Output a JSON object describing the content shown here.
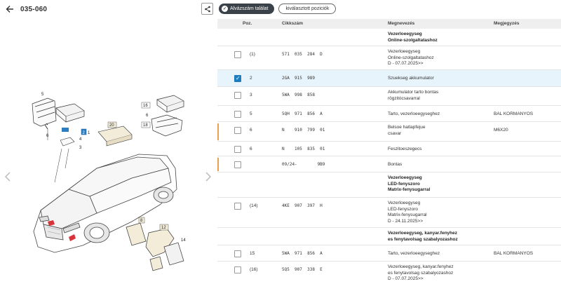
{
  "header": {
    "title": "035-060"
  },
  "filters": {
    "found_label": "Alvázszám találat",
    "selected_label": "kiválasztott poziciók"
  },
  "columns": {
    "pos": "Poz.",
    "cikk": "Cikkszám",
    "desc": "Megnevezés",
    "note": "Megjegyzés"
  },
  "diagram": {
    "callouts": [
      "5",
      "2",
      "1",
      "6",
      "3",
      "4",
      "20",
      "16",
      "6",
      "18",
      "8",
      "12",
      "14"
    ]
  },
  "rows": [
    {
      "pos": "",
      "cikk": "",
      "desc": [
        "Vezerloeegyseg",
        "Online-szolgaltatashoz"
      ],
      "note": "",
      "bold": true,
      "checkbox": false
    },
    {
      "pos": "(1)",
      "cikk": "571  035  284  D",
      "desc": [
        "Vezerloeegyseg",
        "Online-szolgaltatashoz",
        "D - 07.07.2025>>"
      ],
      "note": "",
      "bold": false,
      "checkbox": true
    },
    {
      "pos": "2",
      "cikk": "2GA  915  989",
      "desc": [
        "Szuekseg akkumulator"
      ],
      "note": "",
      "bold": false,
      "checkbox": true,
      "selected": true
    },
    {
      "pos": "3",
      "cikk": "5WA  998  858",
      "desc": [
        "Akkumulator tarto bontas",
        "rögzitócsavarral"
      ],
      "note": "",
      "bold": false,
      "checkbox": true
    },
    {
      "pos": "5",
      "cikk": "5QH  971  856  A",
      "desc": [
        "Tarto, vezerloeegyseghez"
      ],
      "note": "BAL KORMANYOS",
      "bold": false,
      "checkbox": true
    },
    {
      "pos": "6",
      "cikk": "N    910  799  01",
      "desc": [
        "Belsoe hatlapfejue",
        "csavar"
      ],
      "note": "M6X20",
      "bold": false,
      "checkbox": true,
      "marked": true
    },
    {
      "pos": "6",
      "cikk": "N    105  835  01",
      "desc": [
        "Feszitoeszegecs"
      ],
      "note": "",
      "bold": false,
      "checkbox": true
    },
    {
      "pos": "",
      "cikk": "09/24-        9B9",
      "desc": [
        "Bontas"
      ],
      "note": "",
      "bold": false,
      "checkbox": true,
      "marked": true
    },
    {
      "pos": "",
      "cikk": "",
      "desc": [
        "Vezerloeegyseg",
        "LED-fenyszoro",
        "Matrix-fenysugarral"
      ],
      "note": "",
      "bold": true,
      "checkbox": false
    },
    {
      "pos": "(14)",
      "cikk": "4KE  907  397  H",
      "desc": [
        "Vezerloeegyseg",
        "LED-fenyszoro",
        "Matrix-fenysugarral",
        "D - 24.11.2025>>"
      ],
      "note": "",
      "bold": false,
      "checkbox": true
    },
    {
      "pos": "",
      "cikk": "",
      "desc": [
        "Vezerloeegyseg, kanyar.fenyhez",
        "es fenytavolsag szabalyozashoz"
      ],
      "note": "",
      "bold": true,
      "checkbox": false
    },
    {
      "pos": "15",
      "cikk": "5WA  971  856  A",
      "desc": [
        "Tarto, vezerloeegyseghez"
      ],
      "note": "BAL KORMANYOS",
      "bold": false,
      "checkbox": true
    },
    {
      "pos": "(16)",
      "cikk": "5Q5  907  338  E",
      "desc": [
        "Vezerloeegyseg, kanyar.fenyhez",
        "es fenytavolsag szabalyozashoz",
        "D - 07.07.2025>>"
      ],
      "note": "",
      "bold": false,
      "checkbox": true
    }
  ]
}
